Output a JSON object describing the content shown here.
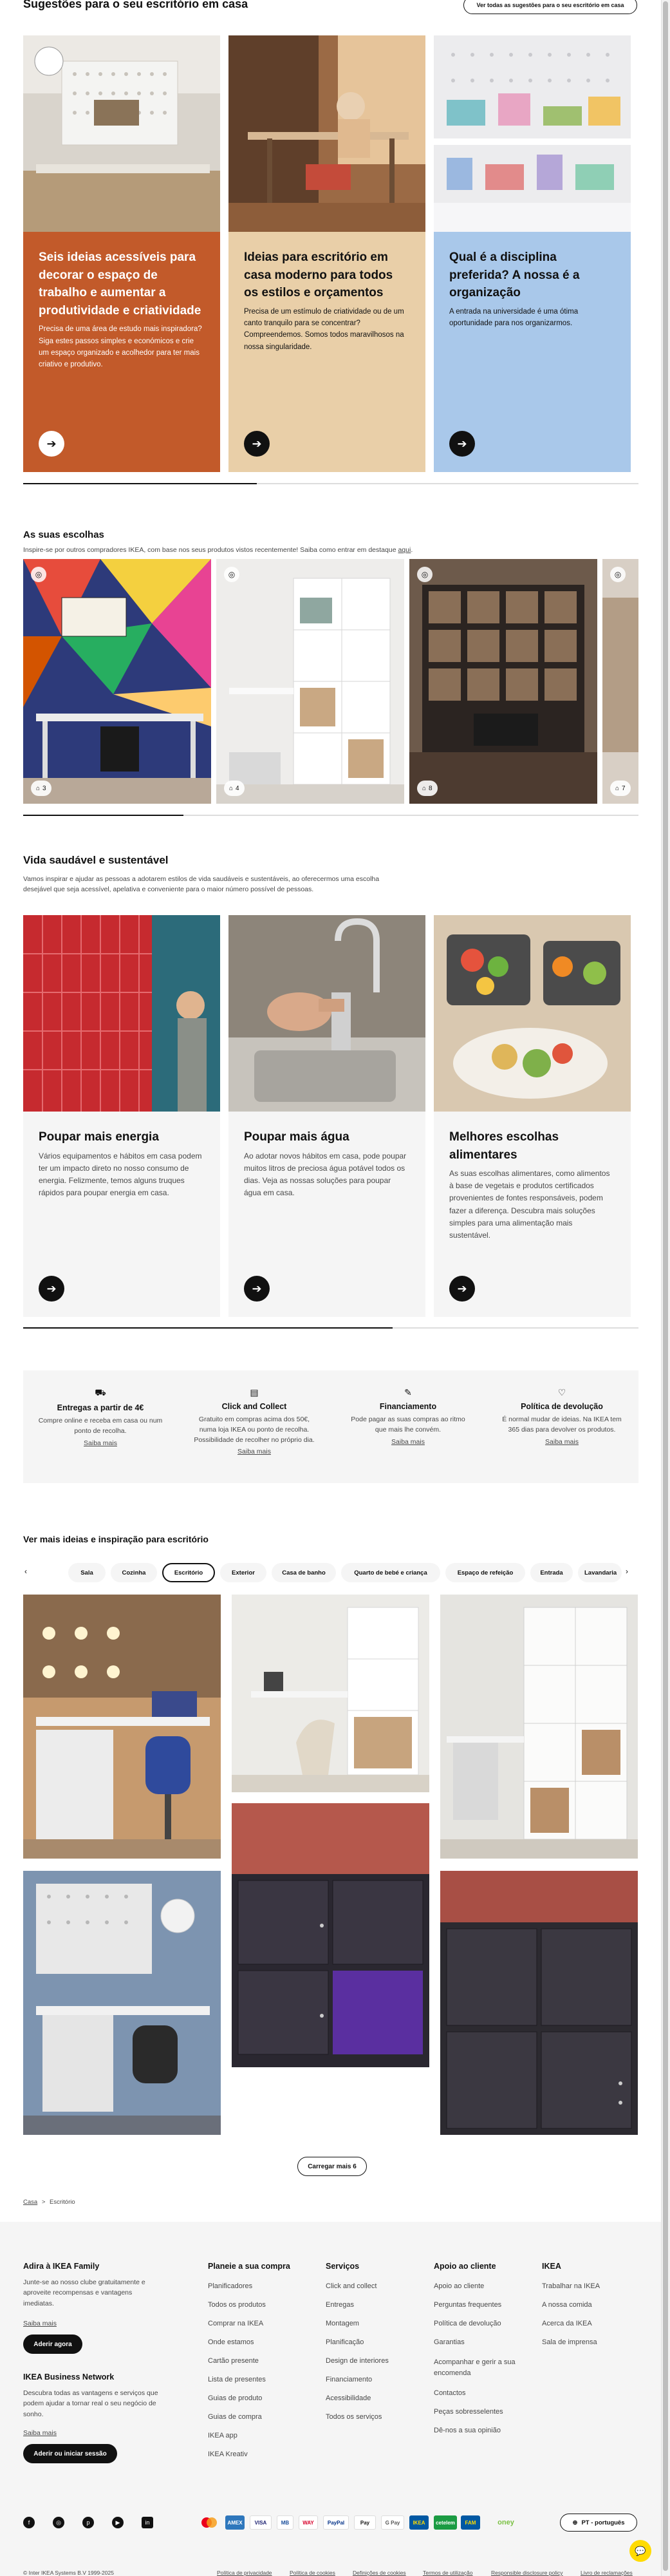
{
  "ideas": {
    "title": "Sugestões para o seu escritório em casa",
    "see_all": "Ver todas as sugestões para o seu escritório em casa",
    "cards": [
      {
        "title": "Seis ideias acessíveis para decorar o espaço de trabalho e aumentar a produtividade e criatividade",
        "desc": "Precisa de uma área de estudo mais inspiradora? Siga estes passos simples e económicos e crie um espaço organizado e acolhedor para ter mais criativo e produtivo.",
        "bg": "#C25A2A"
      },
      {
        "title": "Ideias para escritório em casa moderno para todos os estilos e orçamentos",
        "desc": "Precisa de um estímulo de criatividade ou de um canto tranquilo para se concentrar? Compreendemos. Somos todos maravilhosos na nossa singularidade.",
        "bg": "#E9CFA8"
      },
      {
        "title": "Qual é a disciplina preferida? A nossa é a organização",
        "desc": "A entrada na universidade é uma ótima oportunidade para nos organizarmos.",
        "bg": "#A9C8EA"
      }
    ],
    "progress": 0.38
  },
  "styles": {
    "title": "As suas escolhas",
    "desc": "Inspire-se por outros compradores IKEA, com base nos seus produtos vistos recentemente! Saiba como entrar em destaque",
    "desc_link": "aqui",
    "cards": [
      {
        "count": "3"
      },
      {
        "count": "4"
      },
      {
        "count": "8"
      },
      {
        "count": "7"
      }
    ],
    "progress": 0.26
  },
  "healthy": {
    "title": "Vida saudável e sustentável",
    "desc": "Vamos inspirar e ajudar as pessoas a adotarem estilos de vida saudáveis e sustentáveis, ao oferecermos uma escolha desejável que seja acessível, apelativa e conveniente para o maior número possível de pessoas.",
    "cards": [
      {
        "title": "Poupar mais energia",
        "desc": "Vários equipamentos e hábitos em casa podem ter um impacto direto no nosso consumo de energia. Felizmente, temos alguns truques rápidos para poupar energia em casa."
      },
      {
        "title": "Poupar mais água",
        "desc": "Ao adotar novos hábitos em casa, pode poupar muitos litros de preciosa água potável todos os dias. Veja as nossas soluções para poupar água em casa."
      },
      {
        "title": "Melhores escolhas alimentares",
        "desc": "As suas escolhas alimentares, como alimentos à base de vegetais e produtos certificados provenientes de fontes responsáveis, podem fazer a diferença. Descubra mais soluções simples para uma alimentação mais sustentável."
      }
    ],
    "progress": 0.6
  },
  "services": [
    {
      "icon": "truck-icon",
      "glyph": "⛟",
      "title": "Entregas a partir de 4€",
      "desc": "Compre online e receba em casa ou num ponto de recolha.",
      "link": "Saiba mais"
    },
    {
      "icon": "store-icon",
      "glyph": "▤",
      "title": "Click and Collect",
      "desc": "Gratuito em compras acima dos 50€, numa loja IKEA ou ponto de recolha. Possibilidade de recolher no próprio dia.",
      "link": "Saiba mais"
    },
    {
      "icon": "finance-icon",
      "glyph": "✎",
      "title": "Financiamento",
      "desc": "Pode pagar as suas compras ao ritmo que mais lhe convém.",
      "link": "Saiba mais"
    },
    {
      "icon": "return-icon",
      "glyph": "♡",
      "title": "Política de devolução",
      "desc": "É normal mudar de ideias. Na IKEA tem 365 dias para devolver os produtos.",
      "link": "Saiba mais"
    }
  ],
  "gallery": {
    "title": "Ver mais ideias e inspiração para escritório",
    "chips": [
      "Sala",
      "Cozinha",
      "Escritório",
      "Exterior",
      "Casa de banho",
      "Quarto de bebé e criança",
      "Espaço de refeição",
      "Entrada",
      "Lavandaria"
    ],
    "active_chip": "Escritório",
    "load_more": "Carregar mais 6"
  },
  "breadcrumb": {
    "home": "Casa",
    "sep": ">",
    "current": "Escritório"
  },
  "footer": {
    "family_title": "Adira à IKEA Family",
    "family_desc": "Junte-se ao nosso clube gratuitamente e aproveite recompensas e vantagens imediatas.",
    "family_link": "Saiba mais",
    "family_btn": "Aderir agora",
    "business_title": "IKEA Business Network",
    "business_desc": "Descubra todas as vantagens e serviços que podem ajudar a tornar real o seu negócio de sonho.",
    "business_link": "Saiba mais",
    "business_btn": "Aderir ou iniciar sessão",
    "columns": [
      {
        "title": "Planeie a sua compra",
        "links": [
          "Planificadores",
          "Todos os produtos",
          "Comprar na IKEA",
          "Onde estamos",
          "Cartão presente",
          "Lista de presentes",
          "Guias de produto",
          "Guias de compra",
          "IKEA app",
          "IKEA Kreativ"
        ]
      },
      {
        "title": "Serviços",
        "links": [
          "Click and collect",
          "Entregas",
          "Montagem",
          "Planificação",
          "Design de interiores",
          "Financiamento",
          "Acessibilidade",
          "Todos os serviços"
        ]
      },
      {
        "title": "Apoio ao cliente",
        "links": [
          "Apoio ao cliente",
          "Perguntas frequentes",
          "Política de devolução",
          "Garantias",
          "Acompanhar e gerir a sua encomenda",
          "Contactos",
          "Peças sobresselentes",
          "Dê-nos a sua opinião"
        ]
      },
      {
        "title": "IKEA",
        "links": [
          "Trabalhar na IKEA",
          "A nossa comida",
          "Acerca da IKEA",
          "Sala de imprensa"
        ]
      }
    ],
    "socials": [
      "facebook-icon",
      "instagram-icon",
      "pinterest-icon",
      "youtube-icon",
      "linkedin-icon"
    ],
    "payments": [
      "VISA",
      "MB",
      "WAY",
      "PayPal",
      "Pay",
      "G Pay",
      "cetelem",
      "oney"
    ],
    "language": "PT - português",
    "copyright": "© Inter IKEA Systems B.V 1999-2025",
    "legal": [
      "Política de privacidade",
      "Política de cookies",
      "Definições de cookies",
      "Termos de utilização",
      "Responsible disclosure policy",
      "Livro de reclamações"
    ]
  }
}
